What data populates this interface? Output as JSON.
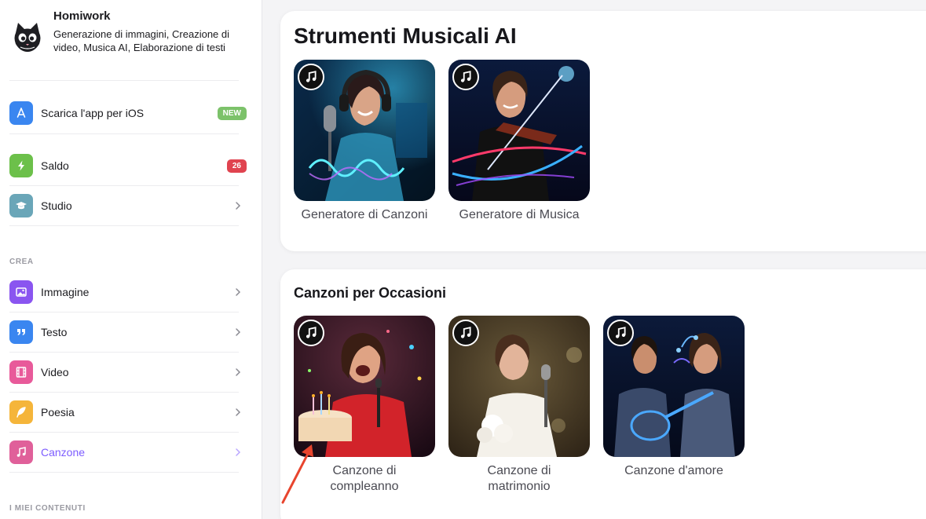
{
  "brand": {
    "name": "Homiwork",
    "description": "Generazione di immagini, Creazione di video, Musica AI, Elaborazione di testi"
  },
  "sidebar": {
    "ios": {
      "label": "Scarica l'app per iOS",
      "badge": "NEW"
    },
    "saldo": {
      "label": "Saldo",
      "badge": "26"
    },
    "studio": {
      "label": "Studio"
    },
    "section_create": "CREA",
    "create_items": [
      {
        "label": "Immagine"
      },
      {
        "label": "Testo"
      },
      {
        "label": "Video"
      },
      {
        "label": "Poesia"
      },
      {
        "label": "Canzone"
      }
    ],
    "section_my": "I MIEI CONTENUTI"
  },
  "main": {
    "tools": {
      "title": "Strumenti Musicali AI",
      "items": [
        {
          "label": "Generatore di Canzoni"
        },
        {
          "label": "Generatore di Musica"
        }
      ]
    },
    "occasions": {
      "title": "Canzoni per Occasioni",
      "items": [
        {
          "label": "Canzone di compleanno"
        },
        {
          "label": "Canzone di matrimonio"
        },
        {
          "label": "Canzone d'amore"
        }
      ]
    }
  },
  "colors": {
    "accent": "#7c5cff",
    "badge_new": "#7cc26a",
    "badge_count": "#e0434f",
    "icon_ios": "#3a86f0",
    "icon_saldo": "#6cc04a",
    "icon_studio": "#6aa6b8",
    "icon_image": "#8a55f0",
    "icon_text": "#3a86f0",
    "icon_video": "#e85a9a",
    "icon_poetry": "#f5b53a",
    "icon_song": "#e0609a",
    "annotation_arrow": "#e8452e"
  },
  "icons": {
    "ios": "app-store-icon",
    "saldo": "lightning-icon",
    "studio": "graduation-cap-icon",
    "image": "image-icon",
    "text": "quote-icon",
    "video": "film-icon",
    "poetry": "feather-icon",
    "song": "music-note-icon"
  }
}
